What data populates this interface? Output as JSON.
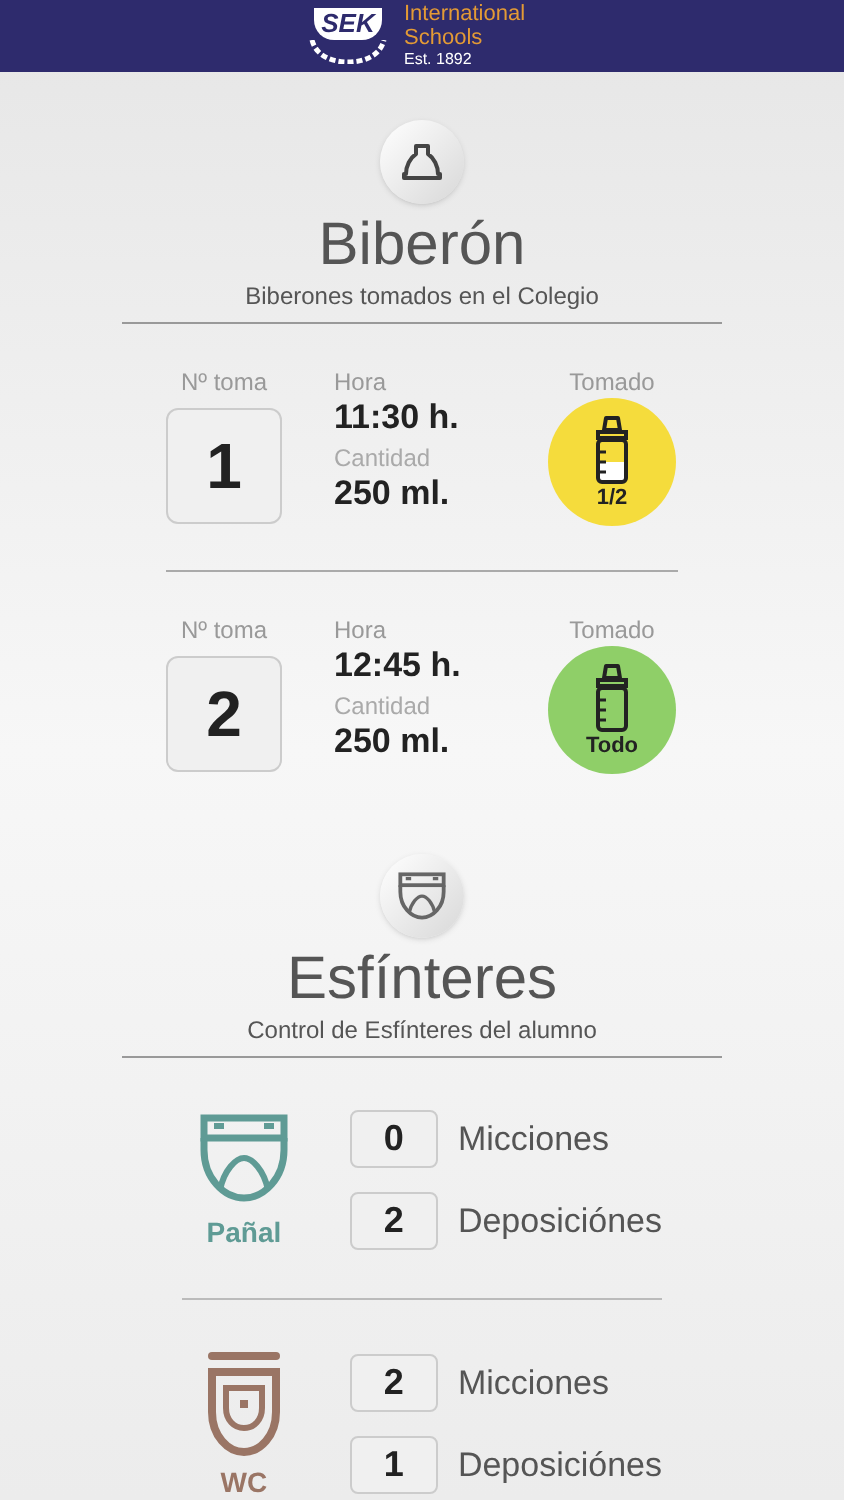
{
  "header": {
    "logo_mark": "SEK",
    "logo_title": "International Schools",
    "logo_subtitle": "Est. 1892"
  },
  "bottles": {
    "title": "Biberón",
    "subtitle": "Biberones tomados en el Colegio",
    "feeds": [
      {
        "number_label": "Nº toma",
        "number": "1",
        "time_label": "Hora",
        "time": "11:30 h.",
        "amount_label": "Cantidad",
        "amount": "250 ml.",
        "taken_label": "Tomado",
        "taken": "1/2",
        "kind": "half",
        "color": "#f5dc3c"
      },
      {
        "number_label": "Nº toma",
        "number": "2",
        "time_label": "Hora",
        "time": "12:45 h.",
        "amount_label": "Cantidad",
        "amount": "250 ml.",
        "taken_label": "Tomado",
        "taken": "Todo",
        "kind": "empty",
        "color": "#8fcf68"
      }
    ]
  },
  "sphincters": {
    "title": "Esfínteres",
    "subtitle": "Control de Esfínteres del alumno",
    "groups": [
      {
        "kind": "diaper",
        "label": "Pañal",
        "color": "#5f9b95",
        "counts": [
          {
            "value": "0",
            "label": "Micciones"
          },
          {
            "value": "2",
            "label": "Deposiciónes"
          }
        ]
      },
      {
        "kind": "toilet",
        "label": "WC",
        "color": "#9a7565",
        "counts": [
          {
            "value": "2",
            "label": "Micciones"
          },
          {
            "value": "1",
            "label": "Deposiciónes"
          }
        ]
      }
    ]
  }
}
